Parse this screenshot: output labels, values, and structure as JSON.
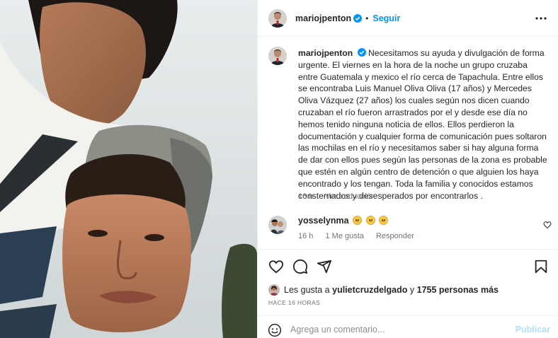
{
  "post": {
    "author": "mariojpenton",
    "follow_label": "Seguir",
    "caption": "Necesitamos su ayuda y divulgación de forma urgente. El viernes en la hora de la noche un grupo cruzaba entre Guatemala y mexico el río cerca de Tapachula. Entre ellos se encontraba Luis Manuel Oliva Oliva (17 años) y Mercedes Oliva Vázquez (27 años) los cuales según nos dicen cuando cruzaban el río fueron arrastrados por el y desde ese día no hemos tenido ninguna noticia de ellos. Ellos perdieron la documentación y cualquier forma de comunicación pues soltaron las mochilas en el río y necesitamos saber si hay alguna forma de dar con ellos pues según las personas de la zona es probable que estén en algún centro de detención o que alguien los haya encontrado y los tengan. Toda la familia y conocidos estamos consternados y desesperados por encontrarlos .",
    "caption_time": "16 h",
    "translate_label": "Ver traducción"
  },
  "comment": {
    "author": "yosselynma",
    "time": "16 h",
    "likes": "1 Me gusta",
    "reply_label": "Responder"
  },
  "likes": {
    "prefix": "Les gusta a",
    "user": "yulietcruzdelgado",
    "connector": "y",
    "others": "1755 personas más"
  },
  "date": "HACE 16 HORAS",
  "composer": {
    "placeholder": "Agrega un comentario...",
    "post_label": "Publicar"
  },
  "colors": {
    "accent": "#0095f6",
    "text": "#262626",
    "muted": "#737373"
  },
  "icons": [
    "more-icon",
    "verified-icon",
    "heart-icon",
    "comment-icon",
    "share-icon",
    "bookmark-icon",
    "emoji-icon"
  ]
}
